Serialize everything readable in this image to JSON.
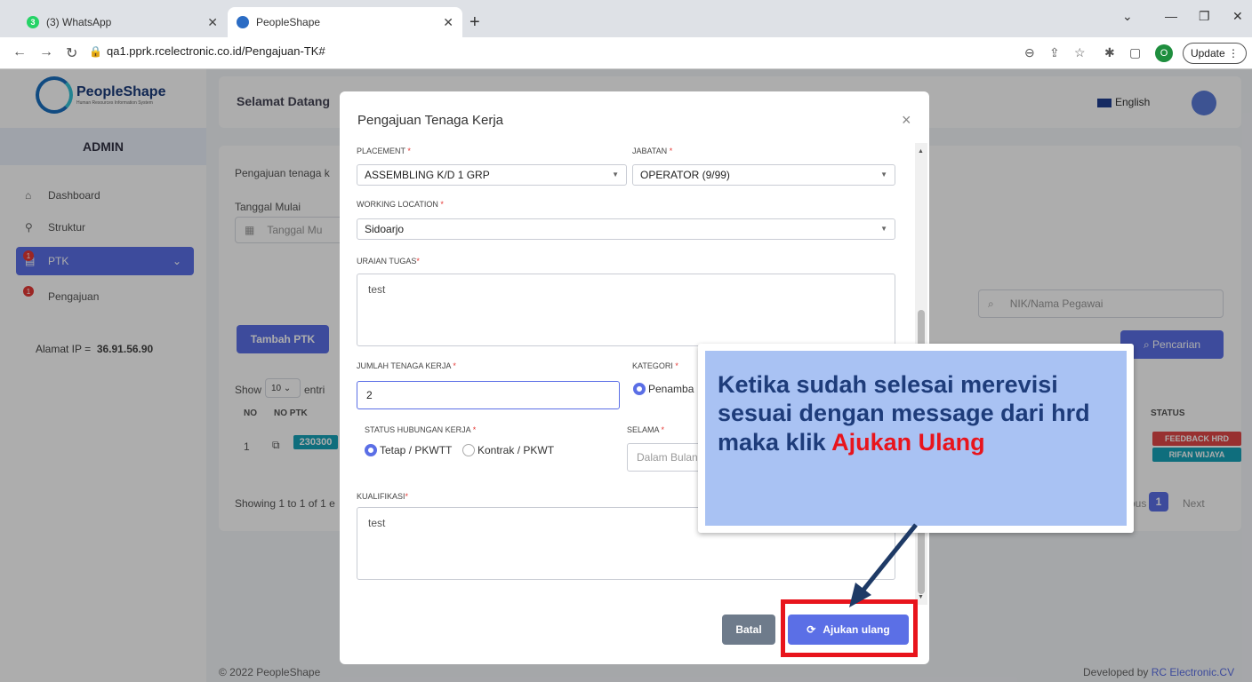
{
  "browser": {
    "tabs": [
      {
        "title": "(3) WhatsApp",
        "badge": "3"
      },
      {
        "title": "PeopleShape"
      }
    ],
    "url": "qa1.pprk.rcelectronic.co.id/Pengajuan-TK#",
    "profile_initial": "O",
    "update_label": "Update"
  },
  "app": {
    "logo_text": "PeopleShape",
    "logo_sub": "Human Resources Information System",
    "role": "ADMIN",
    "sidebar": [
      {
        "label": "Dashboard",
        "icon": "home-icon"
      },
      {
        "label": "Struktur",
        "icon": "sitemap-icon"
      },
      {
        "label": "PTK",
        "icon": "document-icon",
        "badge": "1"
      },
      {
        "label": "Pengajuan",
        "icon": "list-icon",
        "badge": "1"
      }
    ],
    "ip_label": "Alamat IP =",
    "ip_value": "36.91.56.90",
    "welcome": "Selamat Datang",
    "language": "English",
    "main": {
      "intro": "Pengajuan tenaga k",
      "date_label": "Tanggal Mulai",
      "date_placeholder": "Tanggal Mu",
      "add_button": "Tambah PTK",
      "show_label": "Show",
      "show_value": "10",
      "entries_label": "entri",
      "col_no": "NO",
      "col_no_ptk": "NO PTK",
      "col_status": "STATUS",
      "row_no": "1",
      "row_ptk": "230300",
      "status_1": "FEEDBACK HRD",
      "status_2": "RIFAN WIJAYA",
      "showing": "Showing 1 to 1 of 1 e",
      "search_placeholder": "NIK/Nama Pegawai",
      "search_button": "Pencarian",
      "prev_label": "ous",
      "page": "1",
      "next_label": "Next"
    },
    "footer_left": "© 2022 PeopleShape",
    "footer_right_prefix": "Developed by",
    "footer_right_brand": "RC Electronic.CV"
  },
  "modal": {
    "title": "Pengajuan Tenaga Kerja",
    "placement_label": "PLACEMENT",
    "placement_value": "ASSEMBLING K/D 1 GRP",
    "jabatan_label": "JABATAN",
    "jabatan_value": "OPERATOR (9/99)",
    "location_label": "WORKING LOCATION",
    "location_value": "Sidoarjo",
    "uraian_label": "URAIAN TUGAS",
    "uraian_value": "test",
    "jumlah_label": "JUMLAH TENAGA KERJA",
    "jumlah_value": "2",
    "kategori_label": "KATEGORI",
    "kategori_value": "Penamba",
    "status_label": "STATUS HUBUNGAN KERJA",
    "status_opt1": "Tetap / PKWTT",
    "status_opt2": "Kontrak / PKWT",
    "selama_label": "SELAMA",
    "selama_placeholder": "Dalam Bulan",
    "kualifikasi_label": "KUALIFIKASI",
    "kualifikasi_value": "test",
    "cancel_label": "Batal",
    "submit_label": "Ajukan ulang",
    "required_mark": "*"
  },
  "callout": {
    "text": "Ketika sudah selesai merevisi sesuai dengan message dari hrd maka klik",
    "highlight": "Ajukan Ulang"
  },
  "colors": {
    "primary": "#5b6fe6",
    "callout_bg": "#a9c2f3",
    "callout_text": "#1e3c7a",
    "highlight_red": "#e8141c"
  }
}
